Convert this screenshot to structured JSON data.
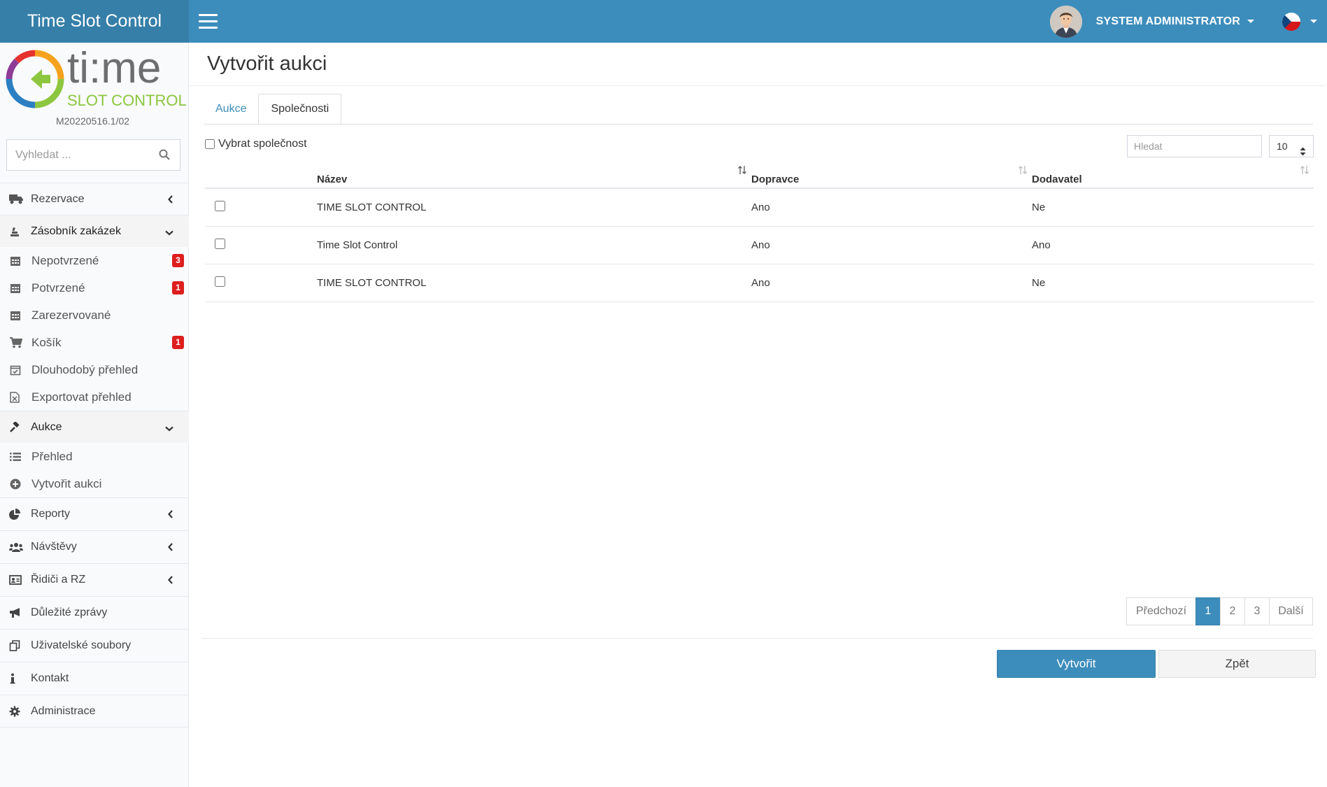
{
  "header": {
    "brand": "Time Slot Control",
    "user": "SYSTEM ADMINISTRATOR"
  },
  "sidebar": {
    "logo_version": "M20220516.1/02",
    "search_placeholder": "Vyhledat ...",
    "rezervace": "Rezervace",
    "zasobnik": "Zásobník zakázek",
    "nepotvrzene": "Nepotvrzené",
    "nepotvrzene_badge": "3",
    "potvrzene": "Potvrzené",
    "potvrzene_badge": "1",
    "zarezervovane": "Zarezervované",
    "kosik": "Košík",
    "kosik_badge": "1",
    "dlouhodoby": "Dlouhodobý přehled",
    "exportovat": "Exportovat přehled",
    "aukce": "Aukce",
    "prehled": "Přehled",
    "vytvorit_aukci": "Vytvořit aukci",
    "reporty": "Reporty",
    "navstevy": "Návštěvy",
    "ridici": "Řidiči a RZ",
    "zpravy": "Důležité zprávy",
    "soubory": "Uživatelské soubory",
    "kontakt": "Kontakt",
    "administrace": "Administrace"
  },
  "main": {
    "title": "Vytvořit aukci",
    "tabs": [
      "Aukce",
      "Společnosti"
    ],
    "select_all_label": "Vybrat společnost",
    "search_placeholder": "Hledat",
    "page_size": "10",
    "columns": [
      "Název",
      "Dopravce",
      "Dodavatel"
    ],
    "rows": [
      {
        "name": "TIME SLOT CONTROL",
        "carrier": "Ano",
        "supplier": "Ne"
      },
      {
        "name": "Time Slot Control",
        "carrier": "Ano",
        "supplier": "Ano"
      },
      {
        "name": "TIME SLOT CONTROL",
        "carrier": "Ano",
        "supplier": "Ne"
      }
    ],
    "pagination": {
      "prev": "Předchozí",
      "pages": [
        "1",
        "2",
        "3"
      ],
      "next": "Další"
    },
    "create_button": "Vytvořit",
    "back_button": "Zpět"
  },
  "colors": {
    "accent": "#3c8dbc",
    "badge": "#dd1e1e",
    "logo_green": "#8dc63f"
  }
}
